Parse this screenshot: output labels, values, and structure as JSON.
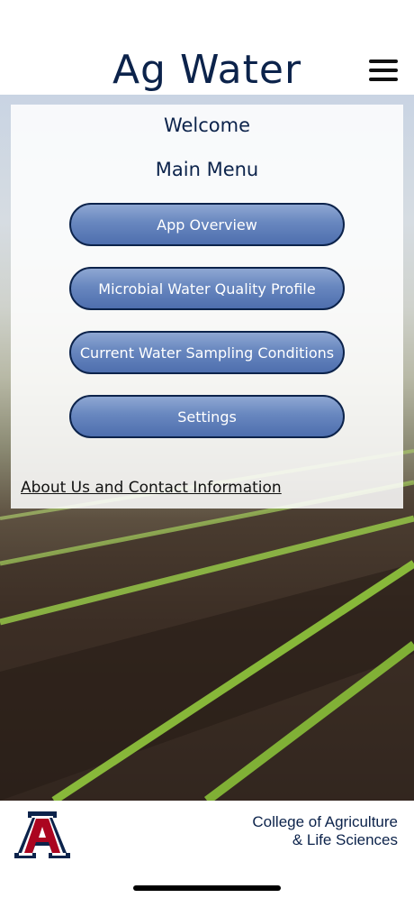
{
  "header": {
    "title": "Ag Water",
    "menu_icon": "hamburger-menu-icon"
  },
  "panel": {
    "welcome": "Welcome",
    "main_menu": "Main Menu",
    "buttons": [
      {
        "label": "App Overview"
      },
      {
        "label": "Microbial Water Quality Profile"
      },
      {
        "label": "Current Water Sampling Conditions"
      },
      {
        "label": "Settings"
      }
    ],
    "about_link": "About Us and Contact Information"
  },
  "footer": {
    "logo_icon": "university-a-logo",
    "college_line1": "College of Agriculture",
    "college_line2": "& Life Sciences"
  },
  "colors": {
    "navy": "#0c234b",
    "red": "#ab0520",
    "button_blue": "#6887bf"
  }
}
